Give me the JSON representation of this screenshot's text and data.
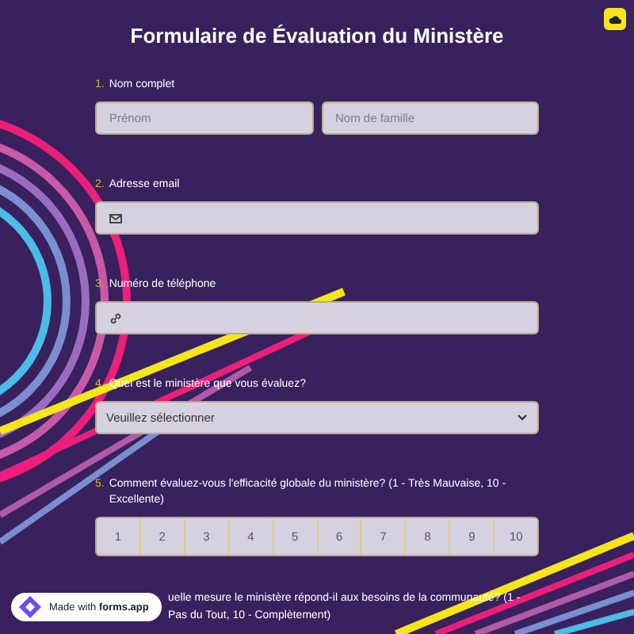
{
  "title": "Formulaire de Évaluation du Ministère",
  "questions": [
    {
      "number": "1.",
      "label": "Nom complet",
      "kind": "name",
      "placeholders": [
        "Prénom",
        "Nom de famille"
      ]
    },
    {
      "number": "2.",
      "label": "Adresse email",
      "kind": "email"
    },
    {
      "number": "3.",
      "label": "Numéro de téléphone",
      "kind": "phone"
    },
    {
      "number": "4.",
      "label": "Quel est le ministère que vous évaluez?",
      "kind": "select",
      "value": "Veuillez sélectionner"
    },
    {
      "number": "5.",
      "label": "Comment évaluez-vous l'efficacité globale du ministère? (1 - Très Mauvaise, 10 - Excellente)",
      "kind": "scale",
      "options": [
        "1",
        "2",
        "3",
        "4",
        "5",
        "6",
        "7",
        "8",
        "9",
        "10"
      ]
    },
    {
      "label": "uelle mesure le ministère répond-il aux besoins de la communauté? (1 - Pas du Tout, 10 - Complètement)",
      "kind": "text"
    }
  ],
  "badge": {
    "prefix": "Made with",
    "brand": "forms.app"
  }
}
